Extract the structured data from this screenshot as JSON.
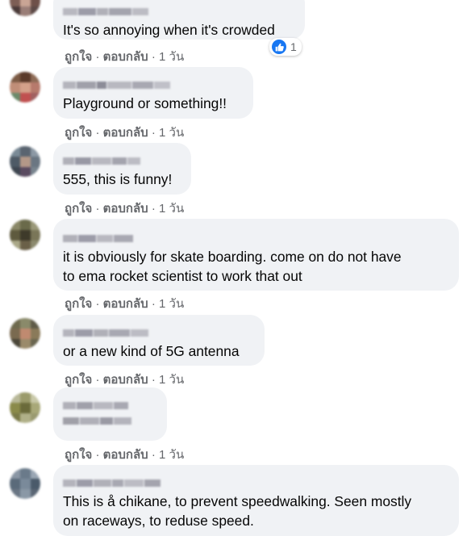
{
  "comments": [
    {
      "text": "It's so annoying when it's crowded",
      "like": "ถูกใจ",
      "sep": "·",
      "reply": "ตอบกลับ",
      "time": "1 วัน",
      "reactions": {
        "icon": "thumbs-up-icon",
        "count": "1"
      }
    },
    {
      "text": "Playground or something!!",
      "like": "ถูกใจ",
      "sep": "·",
      "reply": "ตอบกลับ",
      "time": "1 วัน"
    },
    {
      "text": "555, this is funny!",
      "like": "ถูกใจ",
      "sep": "·",
      "reply": "ตอบกลับ",
      "time": "1 วัน"
    },
    {
      "text_lines": [
        "it is obviously for skate boarding. come on do not have",
        "to ema rocket scientist to work that out"
      ],
      "like": "ถูกใจ",
      "sep": "·",
      "reply": "ตอบกลับ",
      "time": "1 วัน"
    },
    {
      "text": "or a new kind of 5G antenna",
      "like": "ถูกใจ",
      "sep": "·",
      "reply": "ตอบกลับ",
      "time": "1 วัน"
    },
    {
      "text": "",
      "like": "ถูกใจ",
      "sep": "·",
      "reply": "ตอบกลับ",
      "time": "1 วัน"
    },
    {
      "text_lines": [
        "This is å chikane, to prevent speedwalking. Seen mostly",
        "on raceways, to reduse speed."
      ]
    }
  ],
  "colors": {
    "bubble": "#f0f2f5",
    "meta": "#65676b",
    "like_blue": "#1877f2"
  }
}
